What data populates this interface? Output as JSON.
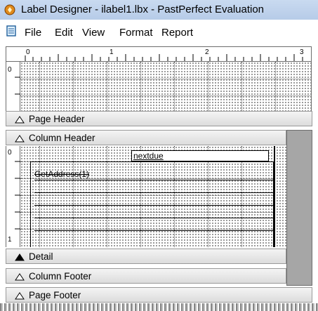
{
  "window": {
    "title": "Label Designer - ilabel1.lbx - PastPerfect Evaluation"
  },
  "menu": {
    "items": [
      "File",
      "Edit",
      "View",
      "Format",
      "Report"
    ]
  },
  "ruler": {
    "marks": [
      "0",
      "1",
      "2",
      "3"
    ],
    "vertical_marks": [
      "0",
      "0",
      "1"
    ]
  },
  "bands": {
    "page_header": "Page Header",
    "column_header": "Column Header",
    "detail": "Detail",
    "column_footer": "Column Footer",
    "page_footer": "Page Footer"
  },
  "fields": {
    "nextdue": "nextdue",
    "address": "GetAddress(1)"
  }
}
